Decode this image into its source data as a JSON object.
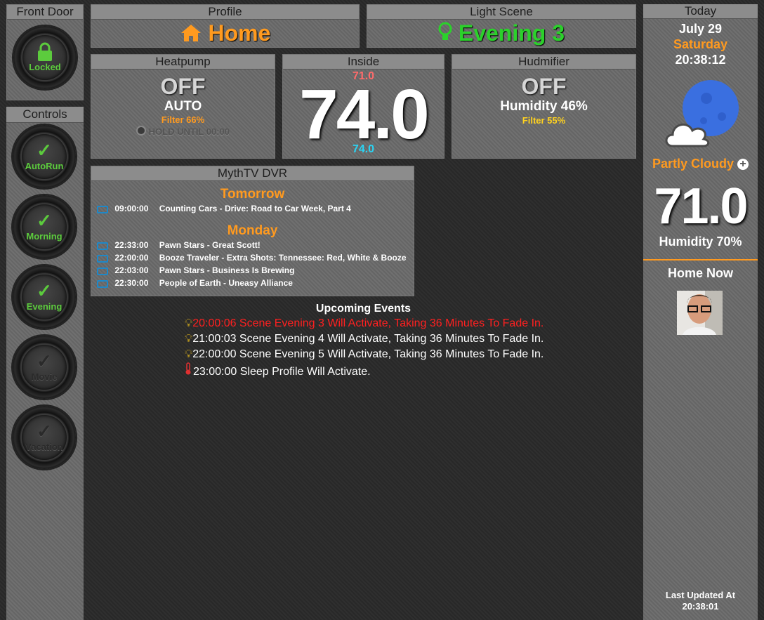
{
  "front_door": {
    "title": "Front Door",
    "lock_label": "Locked"
  },
  "controls": {
    "title": "Controls",
    "buttons": [
      {
        "label": "AutoRun",
        "active": true
      },
      {
        "label": "Morning",
        "active": true
      },
      {
        "label": "Evening",
        "active": true
      },
      {
        "label": "Movie",
        "active": false
      },
      {
        "label": "Vacation",
        "active": false
      }
    ]
  },
  "profile": {
    "title": "Profile",
    "value": "Home",
    "icon": "home-icon",
    "color": "#ff9a1f"
  },
  "light_scene": {
    "title": "Light Scene",
    "value": "Evening 3",
    "icon": "lightbulb-icon",
    "color": "#2bd12b"
  },
  "heatpump": {
    "title": "Heatpump",
    "state": "OFF",
    "mode": "AUTO",
    "filter": "Filter 66%",
    "hold": "HOLD UNTIL 00:00"
  },
  "inside": {
    "title": "Inside",
    "setpoint_high": "71.0",
    "temperature": "74.0",
    "setpoint_low": "74.0"
  },
  "humidifier": {
    "title": "Hudmifier",
    "state": "OFF",
    "humidity": "Humidity 46%",
    "filter": "Filter 55%"
  },
  "dvr": {
    "title": "MythTV DVR",
    "groups": [
      {
        "day": "Tomorrow",
        "items": [
          {
            "time": "09:00:00",
            "title": "Counting Cars - Drive: Road to Car Week, Part 4"
          }
        ]
      },
      {
        "day": "Monday",
        "items": [
          {
            "time": "22:33:00",
            "title": "Pawn Stars - Great Scott!"
          },
          {
            "time": "22:00:00",
            "title": "Booze Traveler - Extra Shots: Tennessee: Red, White & Booze"
          },
          {
            "time": "22:03:00",
            "title": "Pawn Stars - Business Is Brewing"
          },
          {
            "time": "22:30:00",
            "title": "People of Earth - Uneasy Alliance"
          }
        ]
      }
    ]
  },
  "events": {
    "title": "Upcoming Events",
    "items": [
      {
        "icon": "lightbulb-icon",
        "text": "20:00:06 Scene Evening 3 Will Activate, Taking 36 Minutes To Fade In.",
        "color": "#ff2020"
      },
      {
        "icon": "lightbulb-icon",
        "text": "21:00:03 Scene Evening 4 Will Activate, Taking 36 Minutes To Fade In.",
        "color": "#ffffff"
      },
      {
        "icon": "lightbulb-icon",
        "text": "22:00:00 Scene Evening 5 Will Activate, Taking 36 Minutes To Fade In.",
        "color": "#ffffff"
      },
      {
        "icon": "thermometer-icon",
        "text": "23:00:00 Sleep Profile Will Activate.",
        "color": "#ffffff"
      }
    ]
  },
  "today": {
    "title": "Today",
    "date": "July 29",
    "weekday": "Saturday",
    "time": "20:38:12",
    "weather": "Partly Cloudy",
    "weather_icon": "moon-cloud-icon",
    "temperature": "71.0",
    "humidity": "Humidity 70%",
    "home_now": "Home Now",
    "last_updated_label": "Last Updated At",
    "last_updated_time": "20:38:01"
  }
}
